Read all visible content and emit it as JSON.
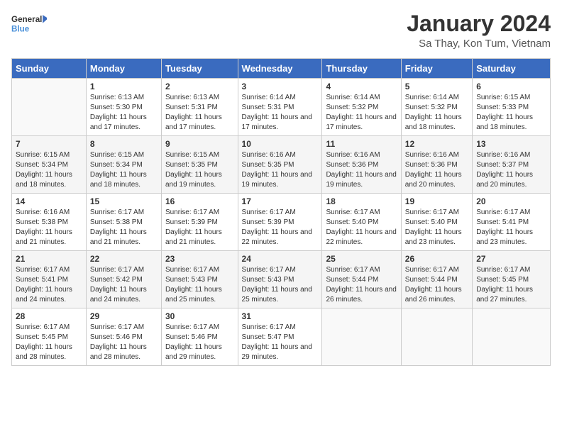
{
  "header": {
    "logo_general": "General",
    "logo_blue": "Blue",
    "month_title": "January 2024",
    "location": "Sa Thay, Kon Tum, Vietnam"
  },
  "days_of_week": [
    "Sunday",
    "Monday",
    "Tuesday",
    "Wednesday",
    "Thursday",
    "Friday",
    "Saturday"
  ],
  "weeks": [
    [
      {
        "day": "",
        "sunrise": "",
        "sunset": "",
        "daylight": ""
      },
      {
        "day": "1",
        "sunrise": "6:13 AM",
        "sunset": "5:30 PM",
        "daylight": "11 hours and 17 minutes."
      },
      {
        "day": "2",
        "sunrise": "6:13 AM",
        "sunset": "5:31 PM",
        "daylight": "11 hours and 17 minutes."
      },
      {
        "day": "3",
        "sunrise": "6:14 AM",
        "sunset": "5:31 PM",
        "daylight": "11 hours and 17 minutes."
      },
      {
        "day": "4",
        "sunrise": "6:14 AM",
        "sunset": "5:32 PM",
        "daylight": "11 hours and 17 minutes."
      },
      {
        "day": "5",
        "sunrise": "6:14 AM",
        "sunset": "5:32 PM",
        "daylight": "11 hours and 18 minutes."
      },
      {
        "day": "6",
        "sunrise": "6:15 AM",
        "sunset": "5:33 PM",
        "daylight": "11 hours and 18 minutes."
      }
    ],
    [
      {
        "day": "7",
        "sunrise": "6:15 AM",
        "sunset": "5:34 PM",
        "daylight": "11 hours and 18 minutes."
      },
      {
        "day": "8",
        "sunrise": "6:15 AM",
        "sunset": "5:34 PM",
        "daylight": "11 hours and 18 minutes."
      },
      {
        "day": "9",
        "sunrise": "6:15 AM",
        "sunset": "5:35 PM",
        "daylight": "11 hours and 19 minutes."
      },
      {
        "day": "10",
        "sunrise": "6:16 AM",
        "sunset": "5:35 PM",
        "daylight": "11 hours and 19 minutes."
      },
      {
        "day": "11",
        "sunrise": "6:16 AM",
        "sunset": "5:36 PM",
        "daylight": "11 hours and 19 minutes."
      },
      {
        "day": "12",
        "sunrise": "6:16 AM",
        "sunset": "5:36 PM",
        "daylight": "11 hours and 20 minutes."
      },
      {
        "day": "13",
        "sunrise": "6:16 AM",
        "sunset": "5:37 PM",
        "daylight": "11 hours and 20 minutes."
      }
    ],
    [
      {
        "day": "14",
        "sunrise": "6:16 AM",
        "sunset": "5:38 PM",
        "daylight": "11 hours and 21 minutes."
      },
      {
        "day": "15",
        "sunrise": "6:17 AM",
        "sunset": "5:38 PM",
        "daylight": "11 hours and 21 minutes."
      },
      {
        "day": "16",
        "sunrise": "6:17 AM",
        "sunset": "5:39 PM",
        "daylight": "11 hours and 21 minutes."
      },
      {
        "day": "17",
        "sunrise": "6:17 AM",
        "sunset": "5:39 PM",
        "daylight": "11 hours and 22 minutes."
      },
      {
        "day": "18",
        "sunrise": "6:17 AM",
        "sunset": "5:40 PM",
        "daylight": "11 hours and 22 minutes."
      },
      {
        "day": "19",
        "sunrise": "6:17 AM",
        "sunset": "5:40 PM",
        "daylight": "11 hours and 23 minutes."
      },
      {
        "day": "20",
        "sunrise": "6:17 AM",
        "sunset": "5:41 PM",
        "daylight": "11 hours and 23 minutes."
      }
    ],
    [
      {
        "day": "21",
        "sunrise": "6:17 AM",
        "sunset": "5:41 PM",
        "daylight": "11 hours and 24 minutes."
      },
      {
        "day": "22",
        "sunrise": "6:17 AM",
        "sunset": "5:42 PM",
        "daylight": "11 hours and 24 minutes."
      },
      {
        "day": "23",
        "sunrise": "6:17 AM",
        "sunset": "5:43 PM",
        "daylight": "11 hours and 25 minutes."
      },
      {
        "day": "24",
        "sunrise": "6:17 AM",
        "sunset": "5:43 PM",
        "daylight": "11 hours and 25 minutes."
      },
      {
        "day": "25",
        "sunrise": "6:17 AM",
        "sunset": "5:44 PM",
        "daylight": "11 hours and 26 minutes."
      },
      {
        "day": "26",
        "sunrise": "6:17 AM",
        "sunset": "5:44 PM",
        "daylight": "11 hours and 26 minutes."
      },
      {
        "day": "27",
        "sunrise": "6:17 AM",
        "sunset": "5:45 PM",
        "daylight": "11 hours and 27 minutes."
      }
    ],
    [
      {
        "day": "28",
        "sunrise": "6:17 AM",
        "sunset": "5:45 PM",
        "daylight": "11 hours and 28 minutes."
      },
      {
        "day": "29",
        "sunrise": "6:17 AM",
        "sunset": "5:46 PM",
        "daylight": "11 hours and 28 minutes."
      },
      {
        "day": "30",
        "sunrise": "6:17 AM",
        "sunset": "5:46 PM",
        "daylight": "11 hours and 29 minutes."
      },
      {
        "day": "31",
        "sunrise": "6:17 AM",
        "sunset": "5:47 PM",
        "daylight": "11 hours and 29 minutes."
      },
      {
        "day": "",
        "sunrise": "",
        "sunset": "",
        "daylight": ""
      },
      {
        "day": "",
        "sunrise": "",
        "sunset": "",
        "daylight": ""
      },
      {
        "day": "",
        "sunrise": "",
        "sunset": "",
        "daylight": ""
      }
    ]
  ]
}
